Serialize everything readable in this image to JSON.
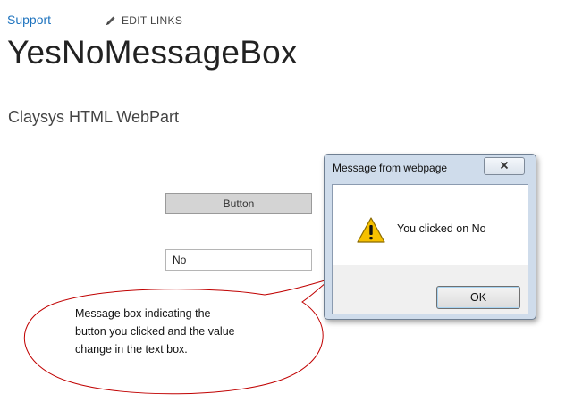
{
  "header": {
    "support_label": "Support",
    "edit_links_label": "EDIT LINKS"
  },
  "page": {
    "title": "YesNoMessageBox",
    "webpart_title": "Claysys HTML WebPart"
  },
  "form": {
    "button_label": "Button",
    "textbox_value": "No"
  },
  "dialog": {
    "title": "Message from webpage",
    "message": "You clicked on No",
    "ok_label": "OK",
    "icon": "warning-icon"
  },
  "callout": {
    "lines": [
      "Message box indicating the",
      "button  you clicked and the value",
      "change in the text box."
    ],
    "border_color": "#c00000"
  }
}
